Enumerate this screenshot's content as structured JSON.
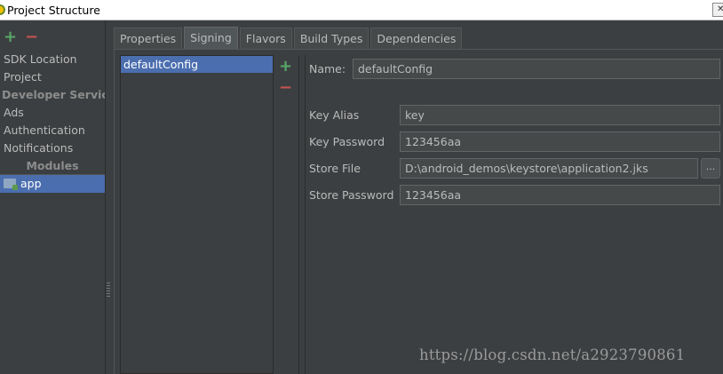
{
  "window": {
    "title": "Project Structure"
  },
  "left": {
    "add_icon": "plus-icon",
    "remove_icon": "minus-icon",
    "items": [
      {
        "label": "SDK Location"
      },
      {
        "label": "Project"
      }
    ],
    "developer_services_header": "Developer Servic...",
    "service_items": [
      {
        "label": "Ads"
      },
      {
        "label": "Authentication"
      },
      {
        "label": "Notifications"
      }
    ],
    "modules_header": "Modules",
    "module_items": [
      {
        "label": "app",
        "icon": "module-folder-icon",
        "selected": true
      }
    ]
  },
  "tabs": [
    {
      "label": "Properties"
    },
    {
      "label": "Signing",
      "active": true
    },
    {
      "label": "Flavors"
    },
    {
      "label": "Build Types"
    },
    {
      "label": "Dependencies"
    }
  ],
  "signing": {
    "configs": [
      {
        "label": "defaultConfig",
        "selected": true
      }
    ],
    "name_label": "Name:",
    "name_value": "defaultConfig",
    "key_alias_label": "Key Alias",
    "key_alias_value": "key",
    "key_password_label": "Key Password",
    "key_password_value": "123456aa",
    "store_file_label": "Store File",
    "store_file_value": "D:\\android_demos\\keystore\\application2.jks",
    "browse_label": "...",
    "store_password_label": "Store Password",
    "store_password_value": "123456aa"
  },
  "watermark": "https://blog.csdn.net/a2923790861",
  "colors": {
    "background": "#3c3f41",
    "selection": "#4b6eaf",
    "add_green": "#59a869",
    "remove_red": "#c75450"
  }
}
